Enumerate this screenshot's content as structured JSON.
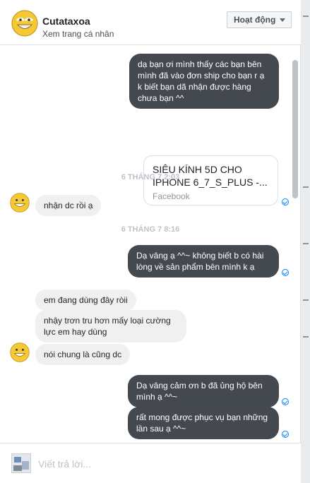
{
  "header": {
    "name": "Cutataxoa",
    "profile_link": "Xem trang cá nhân",
    "status_button": "Hoạt động"
  },
  "messages": {
    "m1": "dạ bạn ơi mình thấy các bạn bên mình đã vào đơn ship cho bạn r ạ k biết bạn dã nhận được hàng chưa bạn ^^",
    "share_title": "SIÊU KÍNH 5D CHO IPHONE 6_7_S_PLUS -...",
    "share_source": "Facebook",
    "stamp1": "6 THÁNG 7 2:03",
    "r1": "nhận dc rồi ạ",
    "stamp2": "6 THÁNG 7 8:16",
    "m2": "Dạ vâng ạ ^^~ không biết b có hài lòng về sản phẩm bên mình k ạ",
    "r2": "em đang dùng đây ròii",
    "r3": "nhậy trơn tru hơn mấy loại cường lực em hay dùng",
    "r4": "nói chung là cũng dc",
    "m3": "Dạ vâng cảm ơn b đã ủng hộ bên mình ạ ^^~",
    "m4": "rất mong được phục vụ bạn những lần sau ạ ^^~"
  },
  "composer": {
    "placeholder": "Viết trả lời..."
  },
  "colors": {
    "outgoing_bubble": "#444950",
    "incoming_bubble": "#f1f0f0",
    "seen_indicator": "#0084ff"
  },
  "icons": {
    "contact_avatar": "grinning-smiley-icon",
    "status_caret": "caret-down-icon",
    "seen": "check-circle-icon",
    "composer_avatar": "user-avatar-photo"
  }
}
